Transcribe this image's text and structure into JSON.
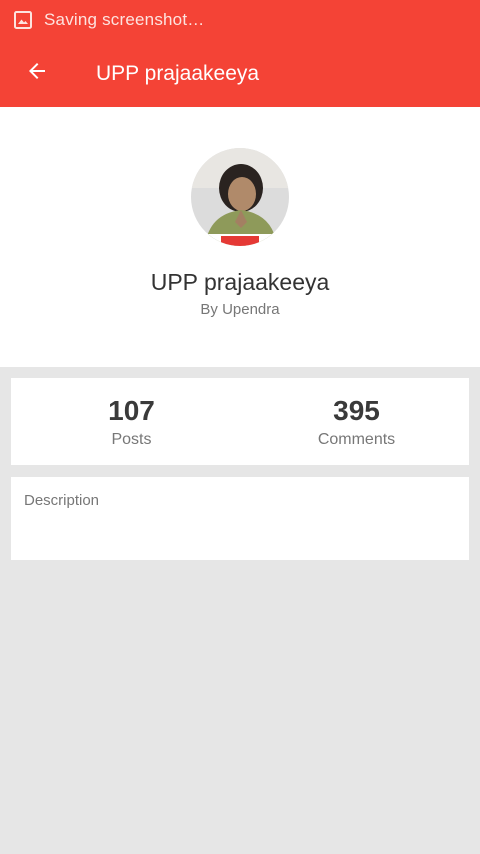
{
  "status_bar": {
    "icon": "screenshot-icon",
    "text": "Saving screenshot…"
  },
  "toolbar": {
    "back_icon": "back-arrow-icon",
    "title": "UPP prajaakeeya"
  },
  "profile": {
    "avatar": "avatar-photo",
    "name": "UPP prajaakeeya",
    "author": "By Upendra"
  },
  "stats": {
    "posts_value": "107",
    "posts_label": "Posts",
    "comments_value": "395",
    "comments_label": "Comments"
  },
  "description": {
    "label": "Description"
  },
  "colors": {
    "accent": "#f44336",
    "background": "#e6e6e6",
    "card": "#ffffff"
  }
}
